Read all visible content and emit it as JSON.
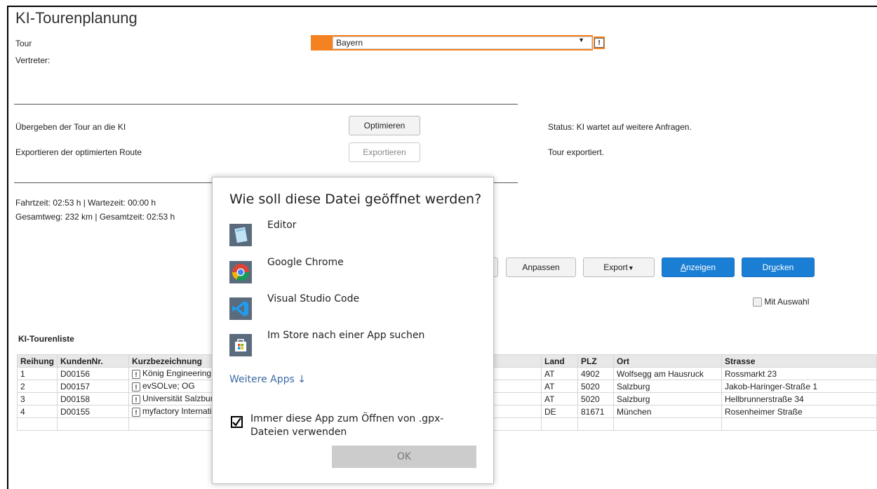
{
  "page": {
    "title": "KI-Tourenplanung",
    "tour_label": "Tour",
    "tour_value": "Bayern",
    "vertreter_label": "Vertreter:",
    "accent_color": "#f58220"
  },
  "actions": {
    "uebergeben_label": "Übergeben der Tour an die KI",
    "optimieren_button": "Optimieren",
    "status_text": "Status: KI wartet auf weitere Anfragen.",
    "exportieren_label": "Exportieren der optimierten Route",
    "exportieren_button": "Exportieren",
    "export_status": "Tour exportiert."
  },
  "summary": {
    "fahrzeit": "Fahrtzeit: 02:53 h | Wartezeit: 00:00 h",
    "gesamtweg": "Gesamtweg: 232 km | Gesamtzeit: 02:53 h"
  },
  "toolbar": {
    "anpassen": "Anpassen",
    "export": "Export",
    "anzeigen_pre": "",
    "anzeigen_ul": "A",
    "anzeigen_post": "nzeigen",
    "drucken_pre": "Dr",
    "drucken_ul": "u",
    "drucken_post": "cken",
    "mit_auswahl": "Mit Auswahl"
  },
  "table": {
    "caption": "KI-Tourenliste",
    "headers": [
      "Reihung",
      "KundenNr.",
      "Kurzbezeichnung",
      "Land",
      "PLZ",
      "Ort",
      "Strasse"
    ],
    "rows": [
      [
        "1",
        "D00156",
        "König Engineering Gr",
        "AT",
        "4902",
        "Wolfsegg am Hausruck",
        "Rossmarkt 23"
      ],
      [
        "2",
        "D00157",
        "evSOLve; OG",
        "AT",
        "5020",
        "Salzburg",
        "Jakob-Haringer-Straße 1"
      ],
      [
        "3",
        "D00158",
        "Universität Salzburg",
        "AT",
        "5020",
        "Salzburg",
        "Hellbrunnerstraße 34"
      ],
      [
        "4",
        "D00155",
        "myfactory Internation",
        "DE",
        "81671",
        "München",
        "Rosenheimer Straße"
      ]
    ]
  },
  "dialog": {
    "title": "Wie soll diese Datei geöffnet werden?",
    "apps": [
      {
        "name": "Editor",
        "icon": "notepad-icon"
      },
      {
        "name": "Google Chrome",
        "icon": "chrome-icon"
      },
      {
        "name": "Visual Studio Code",
        "icon": "vscode-icon"
      },
      {
        "name": "Im Store nach einer App suchen",
        "icon": "store-icon"
      }
    ],
    "more_apps": "Weitere Apps ↓",
    "always_use": "Immer diese App zum Öffnen von .gpx-Dateien verwenden",
    "always_checked": true,
    "ok_button": "OK"
  }
}
